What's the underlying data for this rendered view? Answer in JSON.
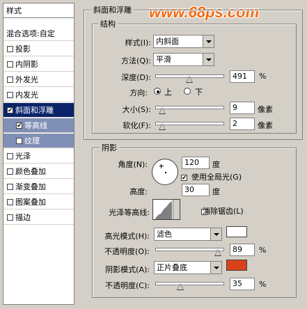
{
  "watermark": "www.68ps.com",
  "left_panel": {
    "title": "样式",
    "blend_options": "混合选项:自定",
    "items": [
      {
        "label": "投影",
        "checked": false
      },
      {
        "label": "内阴影",
        "checked": false
      },
      {
        "label": "外发光",
        "checked": false
      },
      {
        "label": "内发光",
        "checked": false
      },
      {
        "label": "斜面和浮雕",
        "checked": true
      },
      {
        "label": "等高线",
        "checked": true
      },
      {
        "label": "纹理",
        "checked": false
      },
      {
        "label": "光泽",
        "checked": false
      },
      {
        "label": "颜色叠加",
        "checked": false
      },
      {
        "label": "渐变叠加",
        "checked": false
      },
      {
        "label": "图案叠加",
        "checked": false
      },
      {
        "label": "描边",
        "checked": false
      }
    ]
  },
  "bevel": {
    "group_title": "斜面和浮雕",
    "structure": {
      "title": "结构",
      "style_label": "样式(I):",
      "style_value": "内斜面",
      "technique_label": "方法(Q):",
      "technique_value": "平滑",
      "depth_label": "深度(D):",
      "depth_value": "491",
      "depth_unit": "%",
      "depth_level": 0.5,
      "direction_label": "方向:",
      "direction_up": "上",
      "direction_down": "下",
      "size_label": "大小(S):",
      "size_value": "9",
      "size_unit": "像素",
      "soften_label": "软化(F):",
      "soften_value": "2",
      "soften_unit": "像素"
    },
    "shading": {
      "title": "阴影",
      "angle_label": "角度(N):",
      "angle_value": "120",
      "angle_unit": "度",
      "global_light_label": "使用全局光(G)",
      "altitude_label": "高度:",
      "altitude_value": "30",
      "altitude_unit": "度",
      "gloss_label": "光泽等高线:",
      "antialias_label": "消除锯齿(L)",
      "highlight_label": "高光模式(H):",
      "highlight_value": "滤色",
      "highlight_color": "#ffffff",
      "opacity1_label": "不透明度(O):",
      "opacity1_value": "89",
      "opacity_unit": "%",
      "shadow_label": "阴影模式(A):",
      "shadow_value": "正片叠底",
      "shadow_color": "#d9411a",
      "opacity2_label": "不透明度(C):",
      "opacity2_value": "35"
    }
  }
}
